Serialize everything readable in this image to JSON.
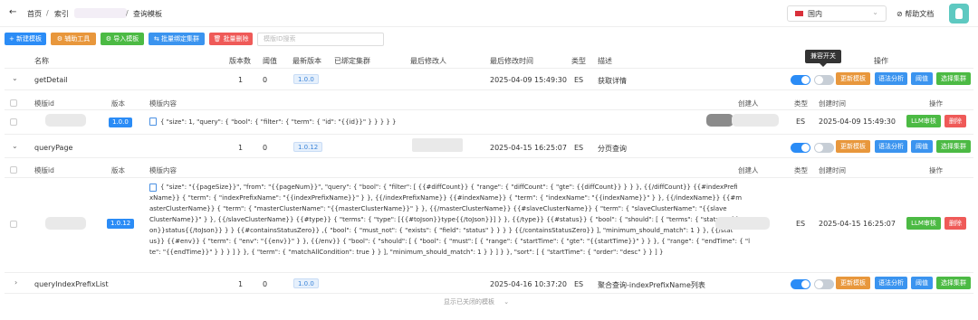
{
  "nav": {
    "back_icon": "arrow-left-icon",
    "breadcrumb_home": "首页",
    "breadcrumb_sep": "/",
    "breadcrumb_index": "索引",
    "breadcrumb_current": "查询模板",
    "region": "国内",
    "region_flag": "china-flag-icon",
    "help": "帮助文档",
    "help_icon": "link-icon"
  },
  "toolbar": {
    "new": "新建模板",
    "aux": "辅助工具",
    "import": "导入模板",
    "bind": "批量绑定集群",
    "delete": "批量删除",
    "search_placeholder": "模版ID搜索"
  },
  "columns": {
    "name": "名称",
    "version_count": "版本数",
    "threshold": "阈值",
    "latest_version": "最新版本",
    "bound_cluster": "已绑定集群",
    "last_modifier": "最后修改人",
    "last_modified": "最后修改时间",
    "type": "类型",
    "desc": "描述",
    "ops": "操作"
  },
  "sub_columns": {
    "template_id": "模版id",
    "version": "版本",
    "content": "模版内容",
    "creator": "创建人",
    "type": "类型",
    "created": "创建时间",
    "ops": "操作"
  },
  "tooltip": "兼容开关",
  "actions": {
    "update": "更新模板",
    "syntax": "语法分析",
    "threshold": "阈值",
    "select_cluster": "选择集群",
    "llm_review": "LLM审核",
    "delete": "删除"
  },
  "templates": [
    {
      "name": "getDetail",
      "version_count": "1",
      "threshold": "0",
      "latest_version": "1.0.0",
      "last_modified": "2025-04-09 15:49:30",
      "type": "ES",
      "desc": "获取详情",
      "sub": {
        "version": "1.0.0",
        "content": "{ \"size\": 1, \"query\": { \"bool\": { \"filter\": { \"term\": { \"id\": \"{{id}}\" } } } } }",
        "type": "ES",
        "created": "2025-04-09 15:49:30"
      }
    },
    {
      "name": "queryPage",
      "version_count": "1",
      "threshold": "0",
      "latest_version": "1.0.12",
      "last_modified": "2025-04-15 16:25:07",
      "type": "ES",
      "desc": "分页查询",
      "sub": {
        "version": "1.0.12",
        "type": "ES",
        "created": "2025-04-15 16:25:07",
        "content_lines": [
          "{ \"size\": \"{{pageSize}}\", \"from\": \"{{pageNum}}\", \"query\": { \"bool\": { \"filter\": [ {{#diffCount}} { \"range\": { \"diffCount\": { \"gte\": {{diffCount}} } } }, {{/diffCount}} {{#indexPrefi",
          "xName}} { \"term\": { \"indexPrefixName\": \"{{indexPrefixName}}\" } }, {{/indexPrefixName}} {{#indexName}} { \"term\": { \"indexName\": \"{{indexName}}\" } }, {{/indexName}} {{#m",
          "asterClusterName}} { \"term\": { \"masterClusterName\": \"{{masterClusterName}}\" } }, {{/masterClusterName}} {{#slaveClusterName}} { \"term\": { \"slaveClusterName\": \"{{slave",
          "ClusterName}}\" } }, {{/slaveClusterName}} {{#type}} { \"terms\": { \"type\": [{{#toJson}}type{{/toJson}}] } }, {{/type}} {{#status}} { \"bool\": { \"should\": [ { \"terms\": { \"status\": {{#toJs",
          "on}}status{{/toJson}} } } {{#containsStatusZero}} ,{ \"bool\": { \"must_not\": { \"exists\": { \"field\": \"status\" } } } } {{/containsStatusZero}} ], \"minimum_should_match\": 1 } }, {{/stat",
          "us}} {{#env}} { \"term\": { \"env\": \"{{env}}\" } }, {{/env}} { \"bool\": { \"should\": [ { \"bool\": { \"must\": [ { \"range\": { \"startTime\": { \"gte\": \"{{startTime}}\" } } }, { \"range\": { \"endTime\": { \"l",
          "te\": \"{{endTime}}\" } } } ] } }, { \"term\": { \"matchAllCondition\": true } } ], \"minimum_should_match\": 1 } } ] } }, \"sort\": [ { \"startTime\": { \"order\": \"desc\" } } ] }"
        ]
      }
    },
    {
      "name": "queryIndexPrefixList",
      "version_count": "1",
      "threshold": "0",
      "latest_version": "1.0.0",
      "last_modified": "2025-04-16 10:37:20",
      "type": "ES",
      "desc": "聚合查询-indexPrefixName列表"
    }
  ],
  "footer": {
    "show_closed": "显示已关闭的模板",
    "chevron": "chevron-down-icon"
  },
  "colors": {
    "primary": "#2b8cf6",
    "orange": "#e8973c",
    "green": "#4cba44",
    "red": "#ef5a58"
  }
}
